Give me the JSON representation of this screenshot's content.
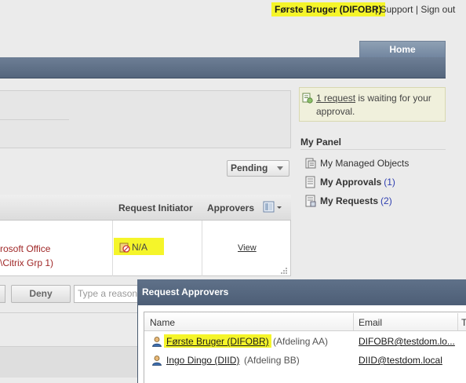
{
  "topbar": {
    "user": "Første Bruger (DIFOBR)",
    "separator": "|",
    "support": "Support",
    "signout": "Sign out"
  },
  "nav": {
    "home_tab": "Home"
  },
  "notification": {
    "link": "1 request",
    "text": " is waiting for your approval."
  },
  "my_panel": {
    "title": "My Panel",
    "items": [
      {
        "label": "My Managed Objects",
        "count": ""
      },
      {
        "label": "My Approvals",
        "count": "(1)"
      },
      {
        "label": "My Requests",
        "count": "(2)"
      }
    ]
  },
  "filter": {
    "selected": "Pending"
  },
  "grid": {
    "columns": [
      "Request Initiator",
      "Approvers"
    ],
    "row": {
      "description_line1": "rosoft Office",
      "description_line2": "\\Citrix Grp 1)",
      "initiator": "N/A",
      "approvers_link": "View"
    }
  },
  "actions": {
    "deny": "Deny",
    "reason_placeholder": "Type a reason"
  },
  "dialog": {
    "title": "Request Approvers",
    "columns": [
      "Name",
      "Email",
      "T"
    ],
    "rows": [
      {
        "name": "Første Bruger (DIFOBR)",
        "dept": "(Afdeling AA)",
        "email": "DIFOBR@testdom.lo..."
      },
      {
        "name": "Ingo Dingo (DIID)",
        "dept": "(Afdeling BB)",
        "email": "DIID@testdom.local"
      }
    ]
  },
  "colors": {
    "highlight": "#f5f52a",
    "nav_band": "#5f7189",
    "link_count": "#2f3fb0",
    "description_text": "#a02828",
    "notification_bg": "#f0f0dc"
  }
}
